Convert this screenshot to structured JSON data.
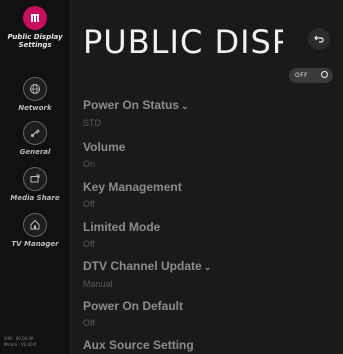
{
  "sidebar": {
    "items": [
      {
        "label": "Public Display Settings",
        "icon": "public-display-icon",
        "active": true
      },
      {
        "label": "Network",
        "icon": "network-icon",
        "active": false
      },
      {
        "label": "General",
        "icon": "general-icon",
        "active": false
      },
      {
        "label": "Media Share",
        "icon": "media-share-icon",
        "active": false
      },
      {
        "label": "TV Manager",
        "icon": "tv-manager-icon",
        "active": false
      }
    ],
    "version_line1": "S/W : 00.00.00",
    "version_line2": "Micom : V2.00.0"
  },
  "header": {
    "title": "PUBLIC DISP...",
    "toggle_label": "OFF"
  },
  "settings": [
    {
      "label": "Power On Status",
      "value": "STD",
      "dropdown": true
    },
    {
      "label": "Volume",
      "value": "On",
      "dropdown": false
    },
    {
      "label": "Key Management",
      "value": "Off",
      "dropdown": false
    },
    {
      "label": "Limited Mode",
      "value": "Off",
      "dropdown": false
    },
    {
      "label": "DTV Channel Update",
      "value": "Manual",
      "dropdown": true
    },
    {
      "label": "Power On Default",
      "value": "Off",
      "dropdown": false
    },
    {
      "label": "Aux Source Setting",
      "value": "",
      "dropdown": false
    }
  ],
  "colors": {
    "accent": "#c80f5f",
    "background": "#1a1a1a",
    "sidebar": "#111111"
  }
}
